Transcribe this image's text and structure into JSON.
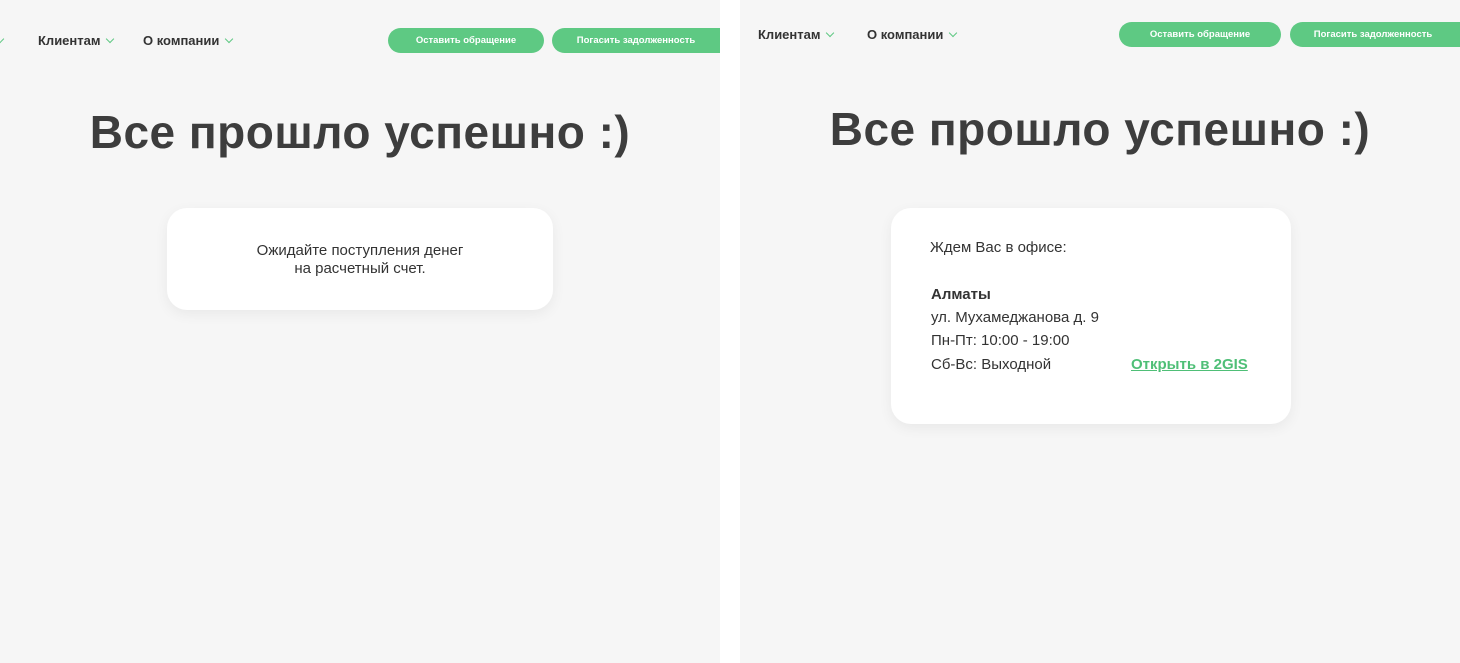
{
  "left": {
    "nav": {
      "clients_label": "Клиентам",
      "about_label": "О компании"
    },
    "buttons": {
      "appeal_label": "Оставить обращение",
      "repay_label": "Погасить задолженность"
    },
    "heading": "Все прошло успешно :)",
    "card": {
      "line1": "Ожидайте поступления денег",
      "line2": "на расчетный счет."
    }
  },
  "right": {
    "nav": {
      "clients_label": "Клиентам",
      "about_label": "О компании"
    },
    "buttons": {
      "appeal_label": "Оставить обращение",
      "repay_label": "Погасить задолженность"
    },
    "heading": "Все прошло успешно :)",
    "card": {
      "intro": "Ждем Вас в офисе:",
      "city": "Алматы",
      "address": "ул. Мухамеджанова д. 9",
      "weekday_hours": "Пн-Пт: 10:00 - 19:00",
      "weekend_hours": "Сб-Вс: Выходной",
      "map_link_label": "Открыть в 2GIS"
    }
  },
  "colors": {
    "accent": "#5ec983",
    "background": "#f6f6f6",
    "heading": "#3d3d3d"
  }
}
